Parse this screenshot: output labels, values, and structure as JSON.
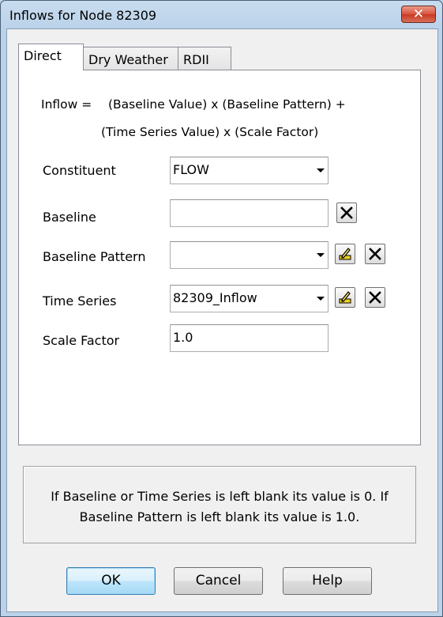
{
  "window": {
    "title": "Inflows for Node 82309",
    "close_glyph": "✕"
  },
  "tabs": [
    {
      "label": "Direct",
      "active": true
    },
    {
      "label": "Dry Weather",
      "active": false
    },
    {
      "label": "RDII",
      "active": false
    }
  ],
  "formula": {
    "line1_lhs": "Inflow  =",
    "line1_rhs": "(Baseline Value) x (Baseline Pattern) +",
    "line2": "(Time Series Value) x (Scale Factor)"
  },
  "fields": {
    "constituent": {
      "label": "Constituent",
      "value": "FLOW"
    },
    "baseline": {
      "label": "Baseline",
      "value": ""
    },
    "baseline_pattern": {
      "label": "Baseline Pattern",
      "value": ""
    },
    "time_series": {
      "label": "Time Series",
      "value": "82309_Inflow"
    },
    "scale_factor": {
      "label": "Scale Factor",
      "value": "1.0"
    }
  },
  "note": {
    "line1": "If Baseline or Time Series is left blank its value is 0. If",
    "line2": "Baseline Pattern is left blank its value is 1.0."
  },
  "buttons": {
    "ok": "OK",
    "cancel": "Cancel",
    "help": "Help"
  },
  "icons": {
    "edit": "pencil-edit-icon",
    "clear": "clear-x-icon"
  },
  "colors": {
    "titlebar": "#bad2ea",
    "close_button": "#c73a22",
    "dialog_bg": "#f0f0f0",
    "default_button": "#bee6fd"
  }
}
